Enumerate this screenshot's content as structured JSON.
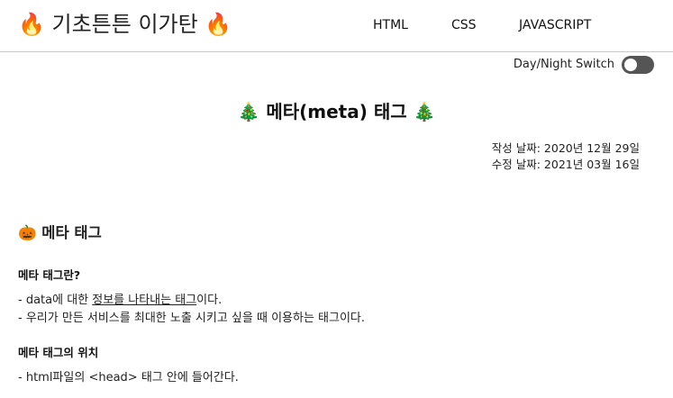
{
  "header": {
    "title": "🔥 기초튼튼 이가탄 🔥",
    "nav": [
      "HTML",
      "CSS",
      "JAVASCRIPT"
    ]
  },
  "theme_switch": {
    "label": "Day/Night Switch",
    "state": "off"
  },
  "article": {
    "title": "🎄 메타(meta) 태그 🎄",
    "created": "작성 날짜: 2020년 12월 29일",
    "modified": "수정 날짜: 2021년 03월 16일",
    "section_heading": "🎃 메타 태그",
    "subsections": [
      {
        "heading": "메타 태그란?",
        "items": [
          {
            "prefix": "- data에 대한 ",
            "underlined": "정보를 나타내는 태그",
            "suffix": "이다."
          },
          {
            "text": "- 우리가 만든 서비스를 최대한 노출 시키고 싶을 때 이용하는 태그이다."
          }
        ]
      },
      {
        "heading": "메타 태그의 위치",
        "items": [
          {
            "text": "- html파일의 <head> 태그 안에 들어간다."
          }
        ]
      }
    ]
  },
  "colors": {
    "background": "#ffffff",
    "text": "#222222",
    "toggle": "#555555",
    "divider": "#c8c8c8"
  }
}
